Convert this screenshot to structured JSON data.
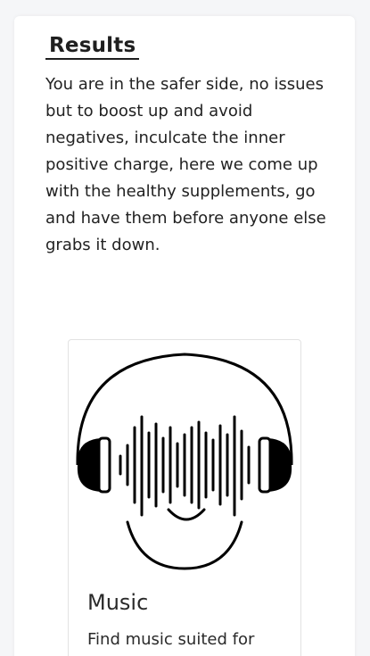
{
  "results": {
    "title": "Results",
    "description": "You are in the safer side, no issues but to boost up and avoid negatives, inculcate the inner positive charge, here we come up with the healthy supplements, go and have them before anyone else grabs it down."
  },
  "card": {
    "title": "Music",
    "description": "Find music suited for",
    "image_icon": "headphones-soundwave-face-icon"
  }
}
